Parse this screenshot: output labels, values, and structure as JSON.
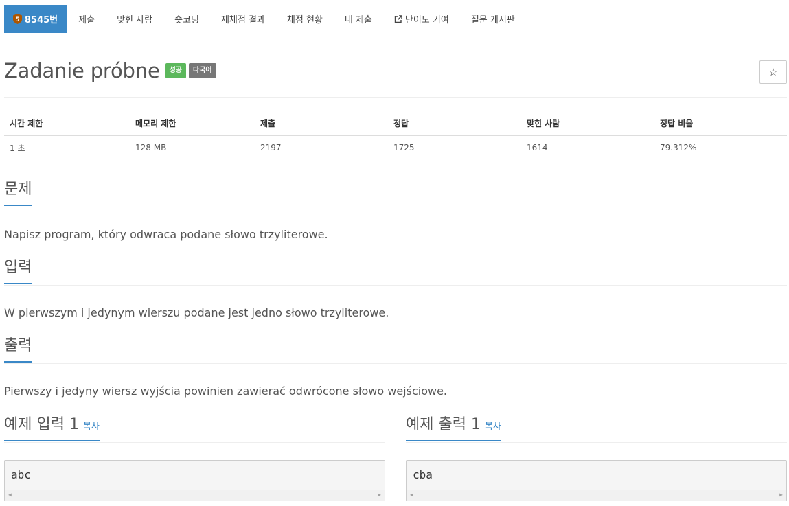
{
  "nav": {
    "problem_tab": "8545번",
    "tier_digit": "5",
    "items": [
      "제출",
      "맞힌 사람",
      "숏코딩",
      "재채점 결과",
      "채점 현황",
      "내 제출",
      "난이도 기여",
      "질문 게시판"
    ]
  },
  "problem": {
    "title": "Zadanie próbne",
    "label_success": "성공",
    "label_multilang": "다국어",
    "star": "☆"
  },
  "stats": {
    "headers": [
      "시간 제한",
      "메모리 제한",
      "제출",
      "정답",
      "맞힌 사람",
      "정답 비율"
    ],
    "values": [
      "1 초",
      "128 MB",
      "2197",
      "1725",
      "1614",
      "79.312%"
    ]
  },
  "sections": {
    "problem_heading": "문제",
    "problem_text": "Napisz program, który odwraca podane słowo trzyliterowe.",
    "input_heading": "입력",
    "input_text": "W pierwszym i jedynym wierszu podane jest jedno słowo trzyliterowe.",
    "output_heading": "출력",
    "output_text": "Pierwszy i jedyny wiersz wyjścia powinien zawierać odwrócone słowo wejściowe."
  },
  "samples": {
    "input_heading": "예제 입력 1",
    "output_heading": "예제 출력 1",
    "copy_label": "복사",
    "input_value": "abc",
    "output_value": "cba"
  },
  "colors": {
    "accent": "#3a88c7",
    "success": "#5cb85c",
    "muted_label": "#777777",
    "tier_bronze": "#ad5600"
  }
}
